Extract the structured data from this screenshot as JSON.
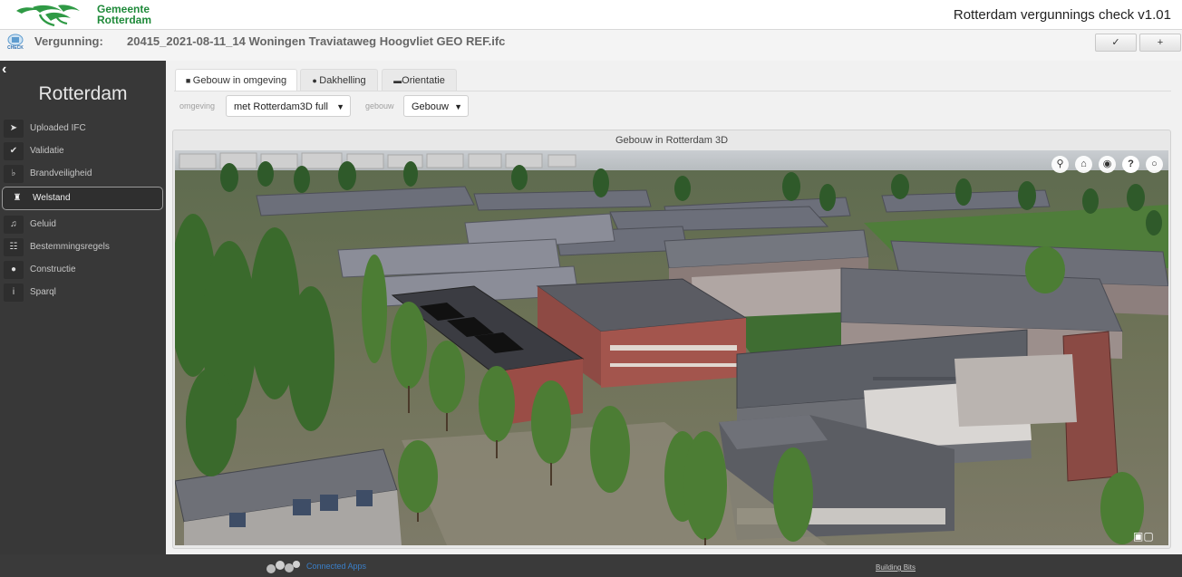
{
  "header": {
    "org_line1": "Gemeente",
    "org_line2": "Rotterdam",
    "app_title": "Rotterdam vergunnings check v1.01",
    "check_logo_text": "CHECK"
  },
  "permit": {
    "label": "Vergunning:",
    "file": "20415_2021-08-11_14 Woningen Traviataweg Hoogvliet GEO REF.ifc",
    "confirm_label": "✓",
    "add_label": "+"
  },
  "sidebar": {
    "city": "Rotterdam",
    "items": [
      {
        "label": "Uploaded IFC",
        "icon": "upload-icon"
      },
      {
        "label": "Validatie",
        "icon": "check-icon"
      },
      {
        "label": "Brandveiligheid",
        "icon": "fire-extinguisher-icon"
      },
      {
        "label": "Welstand",
        "icon": "building-icon",
        "active": true
      },
      {
        "label": "Geluid",
        "icon": "volume-icon"
      },
      {
        "label": "Bestemmingsregels",
        "icon": "map-zones-icon"
      },
      {
        "label": "Constructie",
        "icon": "structure-icon"
      },
      {
        "label": "Sparql",
        "icon": "info-icon"
      }
    ]
  },
  "tabs": [
    {
      "label": "Gebouw in omgeving",
      "active": true
    },
    {
      "label": "Dakhelling",
      "active": false
    },
    {
      "label": "Orientatie",
      "active": false
    }
  ],
  "filters": {
    "omgeving_label": "omgeving",
    "omgeving_value": "met Rotterdam3D full",
    "gebouw_label": "gebouw",
    "gebouw_value": "Gebouw"
  },
  "viewer": {
    "title": "Gebouw in Rotterdam 3D",
    "tools": [
      "search-icon",
      "home-icon",
      "globe-icon",
      "help-icon",
      "settings-icon"
    ]
  },
  "footer": {
    "link1": "Connected Apps",
    "link2": "Building Bits"
  },
  "colors": {
    "sidebar_bg": "#383838",
    "brand_green": "#1f8a3a",
    "footer_bg": "#3a3a3a"
  }
}
